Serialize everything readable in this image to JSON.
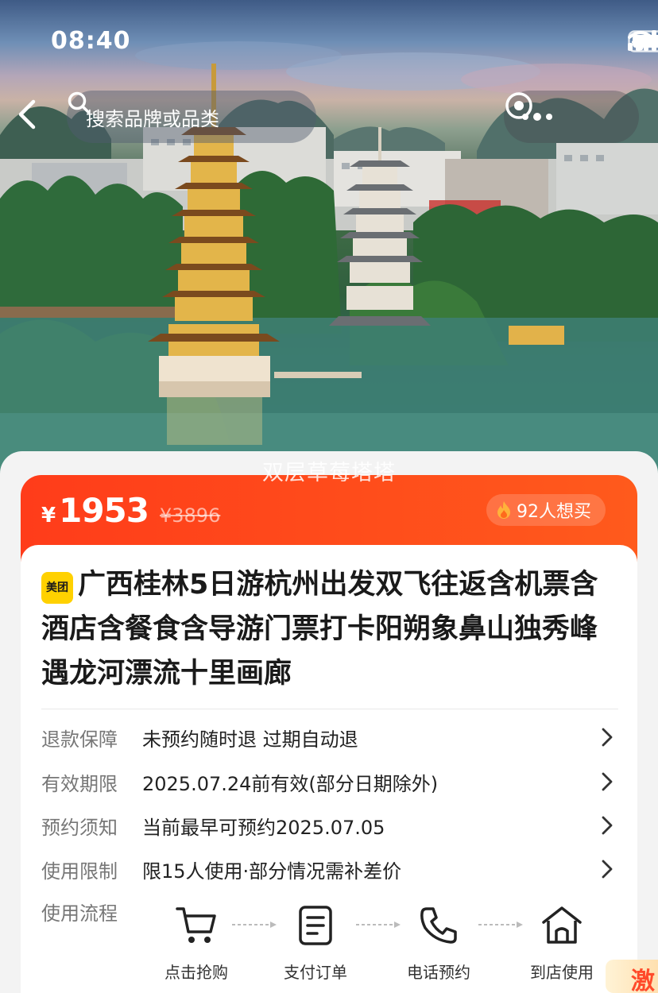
{
  "status_bar": {
    "time": "08:40"
  },
  "nav": {
    "search_placeholder": "搜索品牌或品类"
  },
  "hero": {
    "watermark": "双层草莓塔塔"
  },
  "price": {
    "currency": "¥",
    "current": "1953",
    "original": "¥3896",
    "want_count": "92人想买"
  },
  "product": {
    "platform_logo": "美团",
    "title": "广西桂林5日游杭州出发双飞往返含机票含酒店含餐食含导游门票打卡阳朔象鼻山独秀峰遇龙河漂流十里画廊"
  },
  "info_rows": [
    {
      "label": "退款保障",
      "value": "未预约随时退 过期自动退"
    },
    {
      "label": "有效期限",
      "value": "2025.07.24前有效(部分日期除外)"
    },
    {
      "label": "预约须知",
      "value": "当前最早可预约2025.07.05"
    },
    {
      "label": "使用限制",
      "value": "限15人使用·部分情况需补差价"
    }
  ],
  "usage_flow": {
    "label": "使用流程",
    "steps": [
      {
        "label": "点击抢购",
        "icon": "cart-icon"
      },
      {
        "label": "支付订单",
        "icon": "order-icon"
      },
      {
        "label": "电话预约",
        "icon": "phone-icon"
      },
      {
        "label": "到店使用",
        "icon": "store-icon"
      }
    ]
  },
  "corner_tag": {
    "text": "激"
  },
  "colors": {
    "accent": "#ff4a1c",
    "logo_yellow": "#ffd100"
  }
}
